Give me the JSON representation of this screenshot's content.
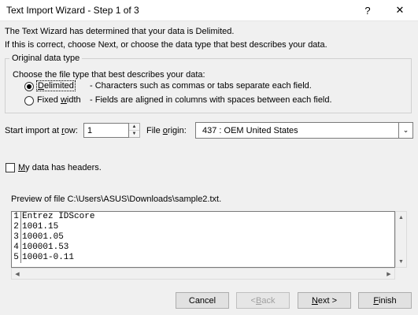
{
  "window": {
    "title": "Text Import Wizard - Step 1 of 3",
    "help_label": "?",
    "close_label": "✕"
  },
  "intro": {
    "line1": "The Text Wizard has determined that your data is Delimited.",
    "line2": "If this is correct, choose Next, or choose the data type that best describes your data."
  },
  "original_data_type": {
    "legend": "Original data type",
    "prompt": "Choose the file type that best describes your data:",
    "options": [
      {
        "label_pre": "",
        "label_key": "D",
        "label_post": "elimited",
        "description": "- Characters such as commas or tabs separate each field.",
        "selected": true
      },
      {
        "label_pre": "Fixed ",
        "label_key": "w",
        "label_post": "idth",
        "description": "- Fields are aligned in columns with spaces between each field.",
        "selected": false
      }
    ]
  },
  "start_row": {
    "label_pre": "Start import at ",
    "label_key": "r",
    "label_post": "ow:",
    "value": "1"
  },
  "file_origin": {
    "label_pre": "File ",
    "label_key": "o",
    "label_post": "rigin:",
    "value": "437 : OEM United States"
  },
  "headers": {
    "label_pre": "",
    "label_key": "M",
    "label_post": "y data has headers.",
    "checked": false
  },
  "preview": {
    "caption": "Preview of file C:\\Users\\ASUS\\Downloads\\sample2.txt.",
    "rows": [
      {
        "num": "1",
        "text": "Entrez IDScore"
      },
      {
        "num": "2",
        "text": "1001.15"
      },
      {
        "num": "3",
        "text": "10001.05"
      },
      {
        "num": "4",
        "text": "100001.53"
      },
      {
        "num": "5",
        "text": "10001-0.11"
      }
    ]
  },
  "buttons": {
    "cancel": "Cancel",
    "back_pre": "< ",
    "back_key": "B",
    "back_post": "ack",
    "next_key": "N",
    "next_post": "ext >",
    "finish_key": "F",
    "finish_post": "inish"
  },
  "icons": {
    "spin_up": "▲",
    "spin_down": "▼",
    "dropdown": "⌄",
    "scroll_up": "▲",
    "scroll_down": "▼",
    "scroll_left": "◀",
    "scroll_right": "▶"
  },
  "colors": {
    "dialog_bg": "#f0f0f0",
    "button_bg": "#e1e1e1",
    "disabled_text": "#a0a0a0"
  }
}
